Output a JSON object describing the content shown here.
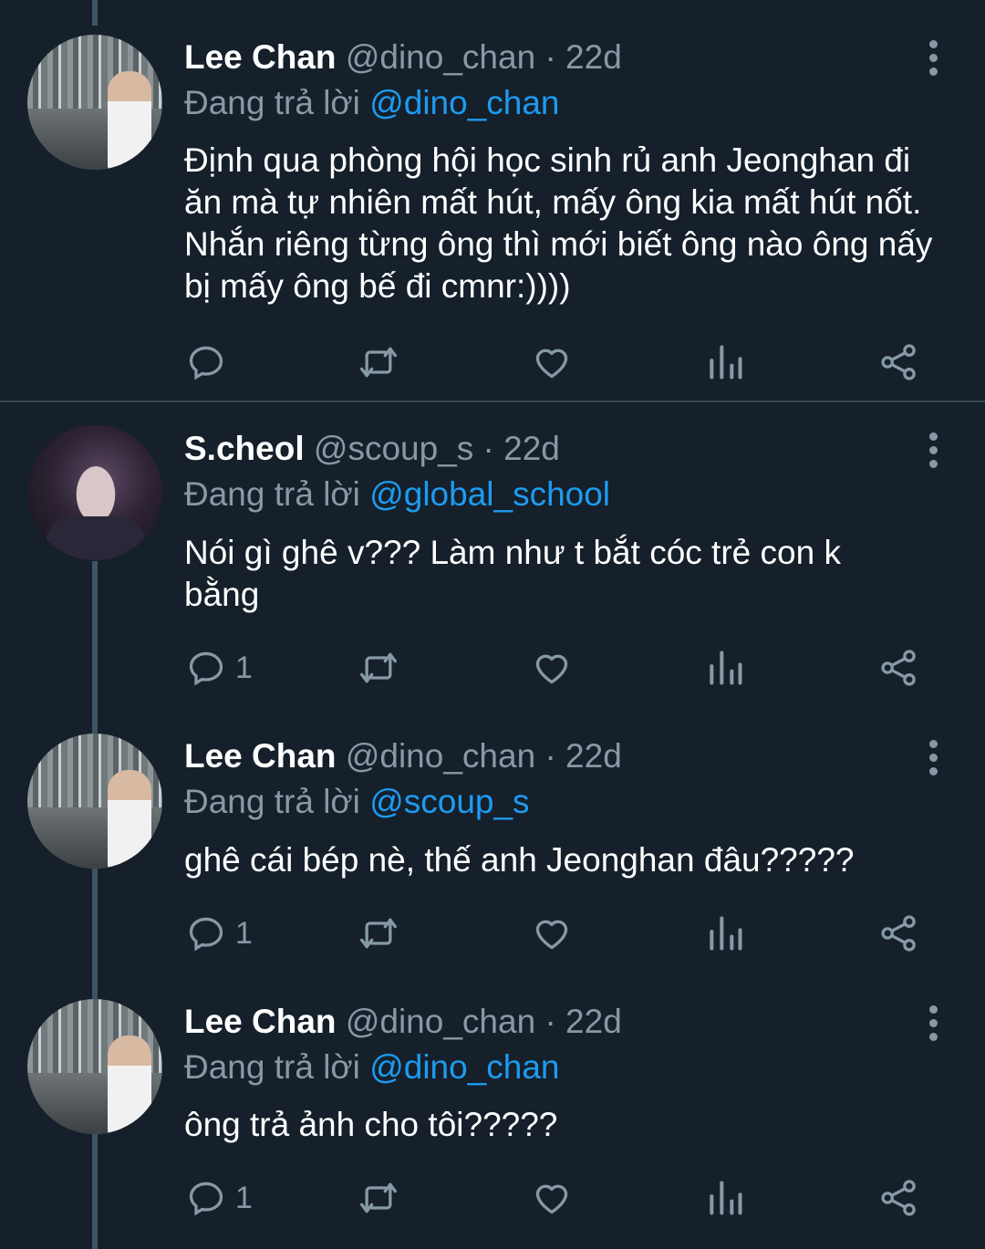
{
  "tweets": [
    {
      "name": "Lee Chan",
      "handle": "@dino_chan",
      "separator": "·",
      "time": "22d",
      "reply_prefix": "Đang trả lời",
      "reply_to": "@dino_chan",
      "text": "Định qua phòng hội học sinh rủ anh Jeonghan đi ăn mà tự nhiên mất hút, mấy ông kia mất hút nốt. Nhắn riêng từng ông thì mới biết ông nào ông nấy bị mấy ông bế đi cmnr:))))",
      "reply_count": ""
    },
    {
      "name": "S.cheol",
      "handle": "@scoup_s",
      "separator": "·",
      "time": "22d",
      "reply_prefix": "Đang trả lời",
      "reply_to": "@global_school",
      "text": "Nói gì ghê v??? Làm như t bắt cóc trẻ con k bằng",
      "reply_count": "1"
    },
    {
      "name": "Lee Chan",
      "handle": "@dino_chan",
      "separator": "·",
      "time": "22d",
      "reply_prefix": "Đang trả lời",
      "reply_to": "@scoup_s",
      "text": "ghê cái bép nè, thế anh Jeonghan đâu?????",
      "reply_count": "1"
    },
    {
      "name": "Lee Chan",
      "handle": "@dino_chan",
      "separator": "·",
      "time": "22d",
      "reply_prefix": "Đang trả lời",
      "reply_to": "@dino_chan",
      "text": "ông trả ảnh cho tôi?????",
      "reply_count": "1"
    }
  ],
  "icons": {
    "reply": "reply-icon",
    "retweet": "retweet-icon",
    "like": "heart-icon",
    "analytics": "analytics-icon",
    "share": "share-icon",
    "more": "more-vertical-icon"
  },
  "colors": {
    "background": "#15202b",
    "muted": "#8899a6",
    "mention": "#1d9bf0",
    "divider": "#38444d"
  }
}
